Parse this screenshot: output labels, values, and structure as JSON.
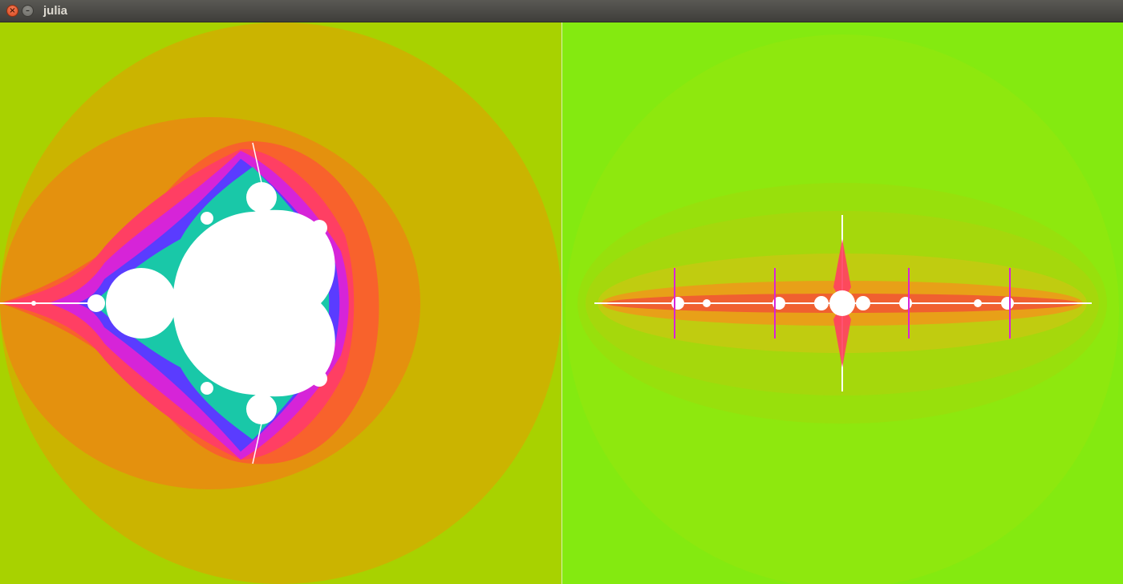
{
  "window": {
    "title": "julia",
    "close_icon": "close-icon",
    "minimize_icon": "minimize-icon"
  },
  "colors": {
    "mandelbrot_background": "#a8d200",
    "julia_background": "#84ea10",
    "fractal_interior": "#ffffff"
  }
}
